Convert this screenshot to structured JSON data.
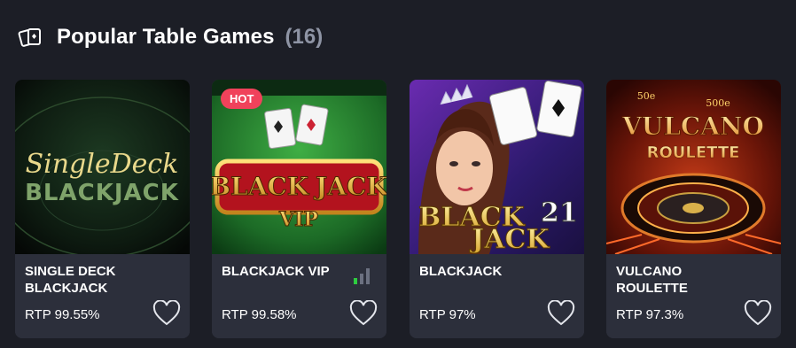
{
  "header": {
    "icon": "cards-category-icon",
    "title": "Popular Table Games",
    "count": "(16)"
  },
  "games": [
    {
      "name": "SINGLE DECK BLACKJACK",
      "rtp": "RTP 99.55%",
      "art_title_1": "SingleDeck",
      "art_title_2": "BLACKJACK"
    },
    {
      "name": "BLACKJACK VIP",
      "rtp": "RTP 99.58%",
      "badge": "HOT",
      "art_title_1": "BLACK",
      "art_title_2": "JACK",
      "art_title_3": "VIP",
      "signal": "signal-bars-icon"
    },
    {
      "name": "BLACKJACK",
      "rtp": "RTP 97%",
      "art_title_1": "BLACK",
      "art_title_2": "JACK",
      "art_number": "21"
    },
    {
      "name": "VULCANO ROULETTE",
      "rtp": "RTP 97.3%",
      "art_title_1": "VULCANO",
      "art_title_2": "ROULETTE",
      "art_bet_1": "50e",
      "art_bet_2": "500e"
    }
  ],
  "colors": {
    "background": "#1c1e26",
    "card": "#2c2f3b",
    "hot_badge": "#f0425b",
    "count": "#8e94a4"
  }
}
